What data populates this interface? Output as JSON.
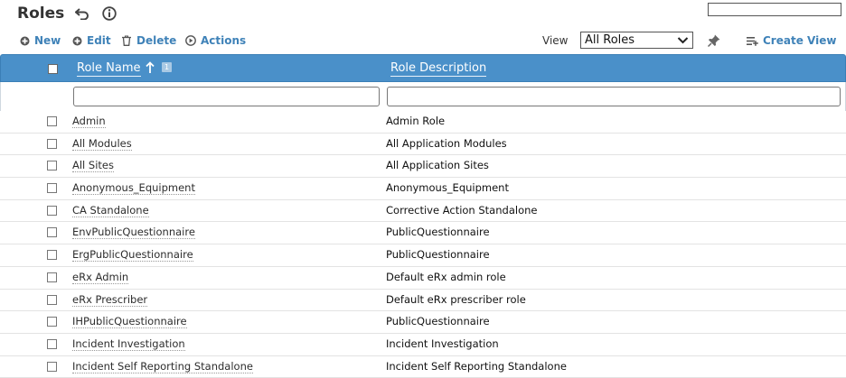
{
  "header": {
    "title": "Roles"
  },
  "toolbar": {
    "new_label": "New",
    "edit_label": "Edit",
    "delete_label": "Delete",
    "actions_label": "Actions",
    "view_label": "View",
    "view_selected": "All Roles",
    "create_view_label": "Create View"
  },
  "grid": {
    "columns": [
      {
        "label": "Role Name",
        "sort": "ascending",
        "sort_order": "1"
      },
      {
        "label": "Role Description"
      }
    ],
    "rows": [
      {
        "name": "Admin",
        "description": "Admin Role"
      },
      {
        "name": "All Modules",
        "description": "All Application Modules"
      },
      {
        "name": "All Sites",
        "description": "All Application Sites"
      },
      {
        "name": "Anonymous_Equipment",
        "description": "Anonymous_Equipment"
      },
      {
        "name": "CA Standalone",
        "description": "Corrective Action Standalone"
      },
      {
        "name": "EnvPublicQuestionnaire",
        "description": "PublicQuestionnaire"
      },
      {
        "name": "ErgPublicQuestionnaire",
        "description": "PublicQuestionnaire"
      },
      {
        "name": "eRx Admin",
        "description": "Default eRx admin role"
      },
      {
        "name": "eRx Prescriber",
        "description": "Default eRx prescriber role"
      },
      {
        "name": "IHPublicQuestionnaire",
        "description": "PublicQuestionnaire"
      },
      {
        "name": "Incident Investigation",
        "description": "Incident Investigation"
      },
      {
        "name": "Incident Self Reporting Standalone",
        "description": "Incident Self Reporting Standalone"
      }
    ]
  },
  "colors": {
    "accent": "#3f82b8",
    "header_bg": "#4a90c9"
  },
  "icons": [
    "undo-icon",
    "info-icon",
    "plus-icon",
    "edit-plus-icon",
    "trash-icon",
    "play-icon",
    "pin-icon",
    "create-view-icon",
    "sort-up-icon"
  ]
}
